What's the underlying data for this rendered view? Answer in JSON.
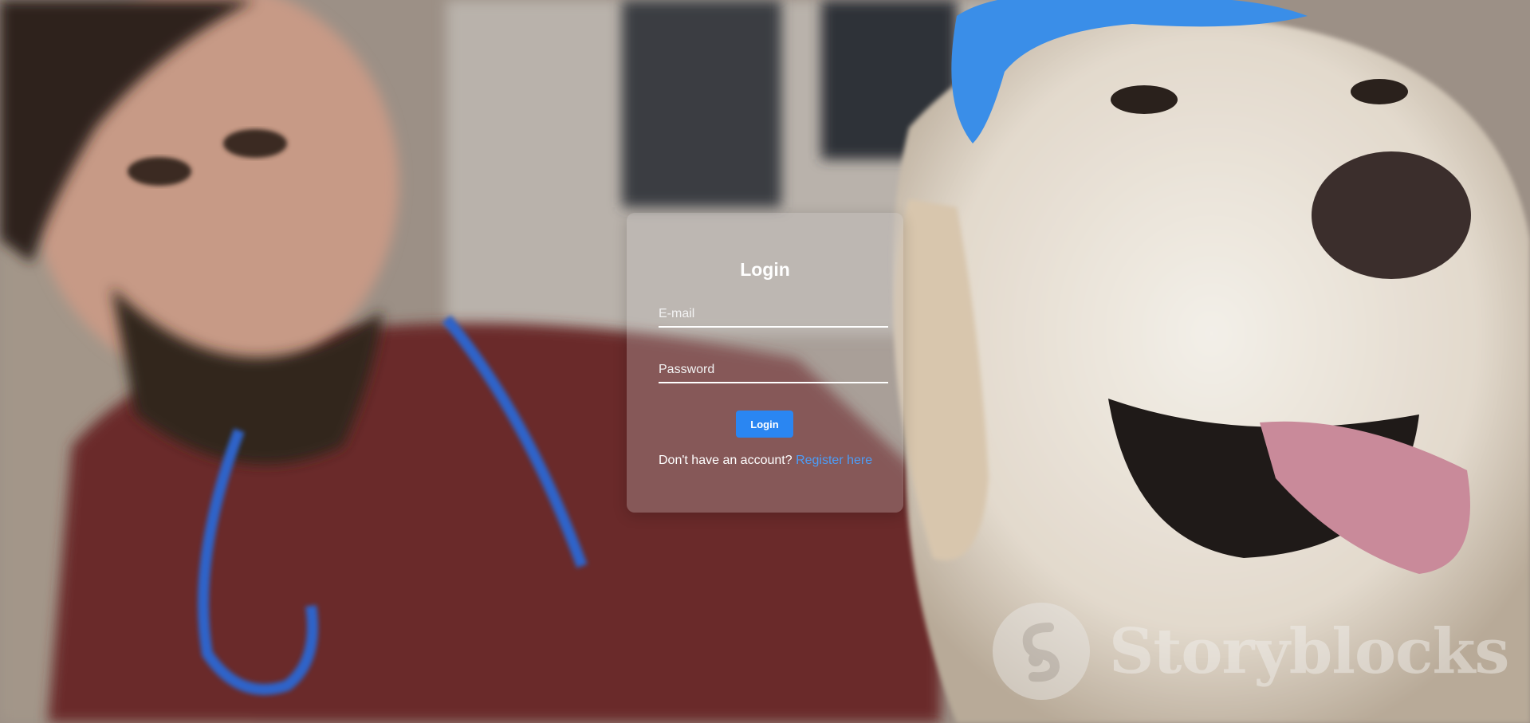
{
  "login": {
    "title": "Login",
    "email_placeholder": "E-mail",
    "password_placeholder": "Password",
    "button_label": "Login",
    "register_prompt": "Don't have an account? ",
    "register_link": "Register here"
  },
  "watermark": {
    "text": "Storyblocks"
  },
  "colors": {
    "button": "#2a86f2",
    "link": "#4d9cf6",
    "card": "rgba(200,195,195,0.30)"
  },
  "icons": [
    "storyblocks-logo-icon"
  ]
}
